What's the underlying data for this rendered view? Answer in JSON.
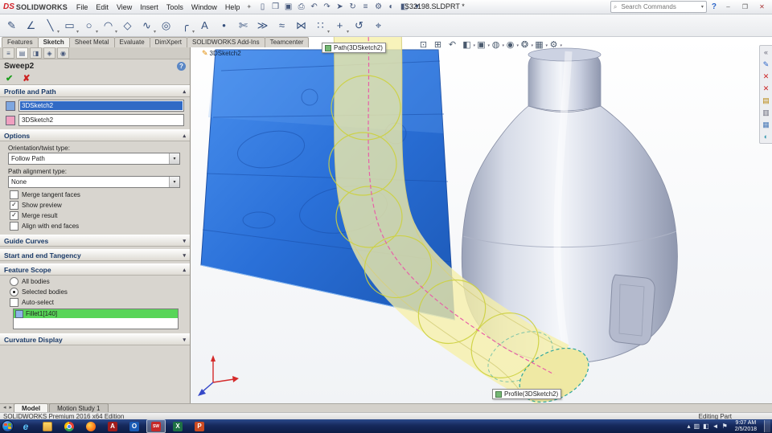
{
  "icons": {
    "chevron_up": "▴",
    "chevron_down": "▾",
    "help_badge": "?",
    "ok": "✔",
    "cancel": "✘",
    "search": "⌕"
  },
  "colors": {
    "selection_blue": "#316ac5",
    "preview_yellow": "#f6f0a8",
    "body_highlight_green": "#58d558",
    "taskbar_blue": "#16295c",
    "logo_red": "#d22027"
  },
  "titlebar": {
    "logo_ds": "DS",
    "logo_text": "SOLIDWORKS",
    "pin_glyph": "✦",
    "menus": [
      {
        "label": "File"
      },
      {
        "label": "Edit"
      },
      {
        "label": "View"
      },
      {
        "label": "Insert"
      },
      {
        "label": "Tools"
      },
      {
        "label": "Window"
      },
      {
        "label": "Help"
      }
    ],
    "quick_icons": [
      {
        "name": "new-file-icon",
        "glyph": "▯"
      },
      {
        "name": "open-file-icon",
        "glyph": "❒"
      },
      {
        "name": "save-icon",
        "glyph": "▣"
      },
      {
        "name": "print-icon",
        "glyph": "⎙"
      },
      {
        "name": "undo-icon",
        "glyph": "↶"
      },
      {
        "name": "redo-icon",
        "glyph": "↷"
      },
      {
        "name": "select-icon",
        "glyph": "➤"
      },
      {
        "name": "rebuild-icon",
        "glyph": "↻"
      },
      {
        "name": "file-properties-icon",
        "glyph": "≡"
      },
      {
        "name": "options-icon",
        "glyph": "⚙"
      },
      {
        "name": "appearance-icon",
        "glyph": "◐"
      },
      {
        "name": "section-icon",
        "glyph": "◧"
      },
      {
        "name": "toolbar-caret-icon",
        "glyph": "▾"
      }
    ],
    "document_title": "S32198.SLDPRT *",
    "search_placeholder": "Search Commands",
    "search_caret": "▾",
    "help_glyph": "?",
    "window": {
      "minimize": "–",
      "maximize": "❐",
      "close": "✕"
    }
  },
  "ribbon": {
    "icons": [
      {
        "name": "exit-sketch-icon",
        "glyph": "✎"
      },
      {
        "name": "smart-dimension-icon",
        "glyph": "∠"
      },
      {
        "name": "line-icon",
        "glyph": "╲",
        "caret": true
      },
      {
        "name": "rectangle-icon",
        "glyph": "▭",
        "caret": true
      },
      {
        "name": "circle-icon",
        "glyph": "○",
        "caret": true
      },
      {
        "name": "arc-icon",
        "glyph": "◠",
        "caret": true
      },
      {
        "name": "polygon-icon",
        "glyph": "◇"
      },
      {
        "name": "spline-icon",
        "glyph": "∿",
        "caret": true
      },
      {
        "name": "ellipse-icon",
        "glyph": "◎"
      },
      {
        "name": "sketch-fillet-icon",
        "glyph": "╭",
        "caret": true
      },
      {
        "name": "text-icon",
        "glyph": "A"
      },
      {
        "name": "point-icon",
        "glyph": "•"
      },
      {
        "name": "trim-entities-icon",
        "glyph": "✄"
      },
      {
        "name": "convert-entities-icon",
        "glyph": "≫"
      },
      {
        "name": "offset-entities-icon",
        "glyph": "≈"
      },
      {
        "name": "mirror-entities-icon",
        "glyph": "⋈"
      },
      {
        "name": "linear-pattern-icon",
        "glyph": "∷",
        "caret": true
      },
      {
        "name": "move-entities-icon",
        "glyph": "+",
        "caret": true
      },
      {
        "name": "display-relations-icon",
        "glyph": "↺"
      },
      {
        "name": "quick-snaps-icon",
        "glyph": "⌖"
      }
    ]
  },
  "commandmanager": {
    "tabs": [
      {
        "name": "tab-features",
        "label": "Features"
      },
      {
        "name": "tab-sketch",
        "label": "Sketch",
        "active": true
      },
      {
        "name": "tab-sheet-metal",
        "label": "Sheet Metal"
      },
      {
        "name": "tab-evaluate",
        "label": "Evaluate"
      },
      {
        "name": "tab-dimxpert",
        "label": "DimXpert"
      },
      {
        "name": "tab-solidworks-add-ins",
        "label": "SOLIDWORKS Add-Ins"
      },
      {
        "name": "tab-teamcenter",
        "label": "Teamcenter"
      }
    ]
  },
  "property_manager": {
    "manager_tabs": [
      {
        "name": "featuremanager-tab-icon",
        "glyph": "≡"
      },
      {
        "name": "propertymanager-tab-icon",
        "glyph": "▤",
        "active": true
      },
      {
        "name": "configurationmanager-tab-icon",
        "glyph": "◨"
      },
      {
        "name": "dimxpertmanager-tab-icon",
        "glyph": "◈"
      },
      {
        "name": "displaymanager-tab-icon",
        "glyph": "◉"
      }
    ],
    "title": "Sweep2",
    "sections": {
      "profile_path": {
        "title": "Profile and Path",
        "profile_value": "3DSketch2",
        "path_value": "3DSketch2"
      },
      "options": {
        "title": "Options",
        "orientation_label": "Orientation/twist type:",
        "orientation_value": "Follow Path",
        "path_alignment_label": "Path alignment type:",
        "path_alignment_value": "None",
        "checkboxes": [
          {
            "name": "merge-tangent-faces-checkbox",
            "label": "Merge tangent faces",
            "checked": false
          },
          {
            "name": "show-preview-checkbox",
            "label": "Show preview",
            "checked": true
          },
          {
            "name": "merge-result-checkbox",
            "label": "Merge result",
            "checked": true
          },
          {
            "name": "align-with-end-faces-checkbox",
            "label": "Align with end faces",
            "checked": false
          }
        ]
      },
      "guide_curves": {
        "title": "Guide Curves"
      },
      "start_end_tangency": {
        "title": "Start and end Tangency"
      },
      "feature_scope": {
        "title": "Feature Scope",
        "radios": [
          {
            "name": "all-bodies-radio",
            "label": "All bodies",
            "checked": false
          },
          {
            "name": "selected-bodies-radio",
            "label": "Selected bodies",
            "checked": true
          }
        ],
        "auto_select_label": "Auto-select",
        "bodies": [
          {
            "name": "feature-scope-body-item",
            "label": "Fillet1[140]",
            "selected": true
          }
        ]
      },
      "curvature_display": {
        "title": "Curvature Display"
      }
    }
  },
  "viewport": {
    "sketch_label": "3DSketch2",
    "callouts": {
      "path": "Path(3DSketch2)",
      "profile": "Profile(3DSketch2)"
    },
    "headsup_icons": [
      {
        "name": "zoom-to-fit-icon",
        "glyph": "⊡"
      },
      {
        "name": "zoom-to-area-icon",
        "glyph": "⊞"
      },
      {
        "name": "previous-view-icon",
        "glyph": "↶"
      },
      {
        "name": "section-view-icon",
        "glyph": "◧",
        "caret": true
      },
      {
        "name": "view-orientation-icon",
        "glyph": "▣",
        "caret": true
      },
      {
        "name": "display-style-icon",
        "glyph": "◍",
        "caret": true
      },
      {
        "name": "hide-show-items-icon",
        "glyph": "◉",
        "caret": true
      },
      {
        "name": "edit-appearance-icon",
        "glyph": "❂",
        "caret": true
      },
      {
        "name": "apply-scene-icon",
        "glyph": "▦",
        "caret": true
      },
      {
        "name": "view-settings-icon",
        "glyph": "⚙",
        "caret": true
      }
    ],
    "taskpane_icons": [
      {
        "name": "collapse-taskpane-icon",
        "glyph": "«",
        "color": "#667"
      },
      {
        "name": "exit-sketch-corner-icon",
        "glyph": "✎",
        "color": "#2a64c8"
      },
      {
        "name": "cancel-feature-icon",
        "glyph": "✕",
        "color": "#cc2222"
      },
      {
        "name": "cancel-sketch-icon",
        "glyph": "✕",
        "color": "#cc2222"
      },
      {
        "name": "design-library-icon",
        "glyph": "▤",
        "color": "#b8860b"
      },
      {
        "name": "file-explorer-icon",
        "glyph": "▥",
        "color": "#667"
      },
      {
        "name": "view-palette-icon",
        "glyph": "▦",
        "color": "#4a7ab8"
      },
      {
        "name": "appearances-icon",
        "glyph": "◐",
        "color": "#3a9ab0"
      }
    ]
  },
  "bottom_tabs": {
    "nav_icons": [
      {
        "name": "tab-scroll-left-icon",
        "glyph": "◂"
      },
      {
        "name": "tab-scroll-right-icon",
        "glyph": "▸"
      }
    ],
    "tabs": [
      {
        "name": "tab-model",
        "label": "Model",
        "active": true
      },
      {
        "name": "tab-motion-study-1",
        "label": "Motion Study 1"
      }
    ]
  },
  "statusbar": {
    "left": "SOLIDWORKS Premium 2016 x64 Edition",
    "right": "Editing Part"
  },
  "taskbar": {
    "apps": [
      {
        "name": "taskbar-internet-explorer",
        "glyph": "e",
        "cls": "ic-ie"
      },
      {
        "name": "taskbar-explorer",
        "glyph": "",
        "cls": "ic-folder"
      },
      {
        "name": "taskbar-chrome",
        "glyph": "",
        "cls": "ic-chrome"
      },
      {
        "name": "taskbar-firefox",
        "glyph": "",
        "cls": "ic-firefox"
      },
      {
        "name": "taskbar-acrobat",
        "glyph": "A",
        "cls": "ic-acrobat"
      },
      {
        "name": "taskbar-outlook",
        "glyph": "O",
        "cls": "ic-outlook"
      },
      {
        "name": "taskbar-solidworks",
        "glyph": "SW",
        "cls": "ic-sw",
        "active": true
      },
      {
        "name": "taskbar-excel",
        "glyph": "X",
        "cls": "ic-excel"
      },
      {
        "name": "taskbar-powerpoint",
        "glyph": "P",
        "cls": "ic-ppt"
      }
    ],
    "tray_icons": [
      {
        "name": "show-hidden-icons-icon",
        "glyph": "▴"
      },
      {
        "name": "power-tray-icon",
        "glyph": "▥"
      },
      {
        "name": "network-tray-icon",
        "glyph": "◧"
      },
      {
        "name": "volume-tray-icon",
        "glyph": "◄"
      },
      {
        "name": "action-center-icon",
        "glyph": "⚑"
      }
    ],
    "clock": {
      "time": "9:07 AM",
      "date": "2/5/2018"
    }
  }
}
